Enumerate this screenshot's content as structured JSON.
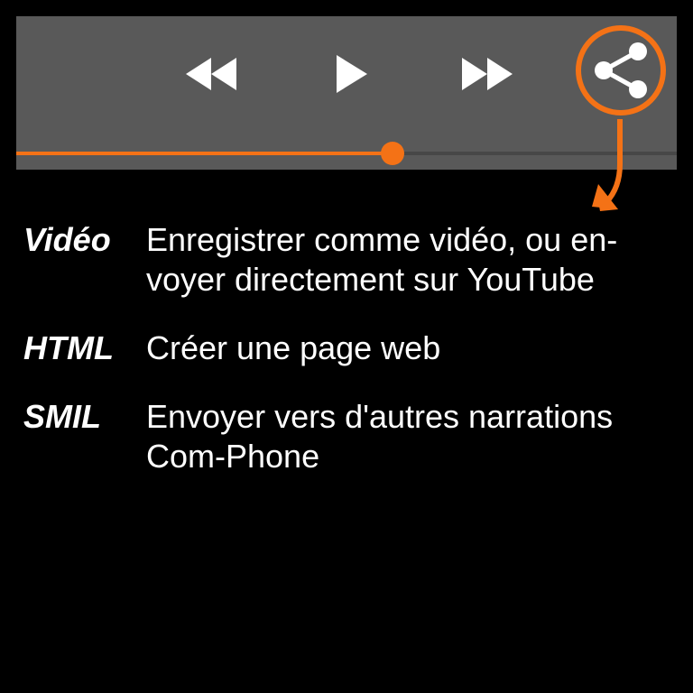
{
  "player": {
    "progress_fraction": 0.57,
    "accent_color": "#f47216",
    "controls": {
      "rewind_icon": "rewind-icon",
      "play_icon": "play-icon",
      "fast_forward_icon": "fast-forward-icon",
      "share_icon": "share-icon"
    }
  },
  "export_options": [
    {
      "term": "Vidéo",
      "description": "Enregistrer comme vidéo, ou en-voyer directement sur YouTube"
    },
    {
      "term": "HTML",
      "description": "Créer une page web"
    },
    {
      "term": "SMIL",
      "description": "Envoyer vers d'autres narrations Com-Phone"
    }
  ]
}
